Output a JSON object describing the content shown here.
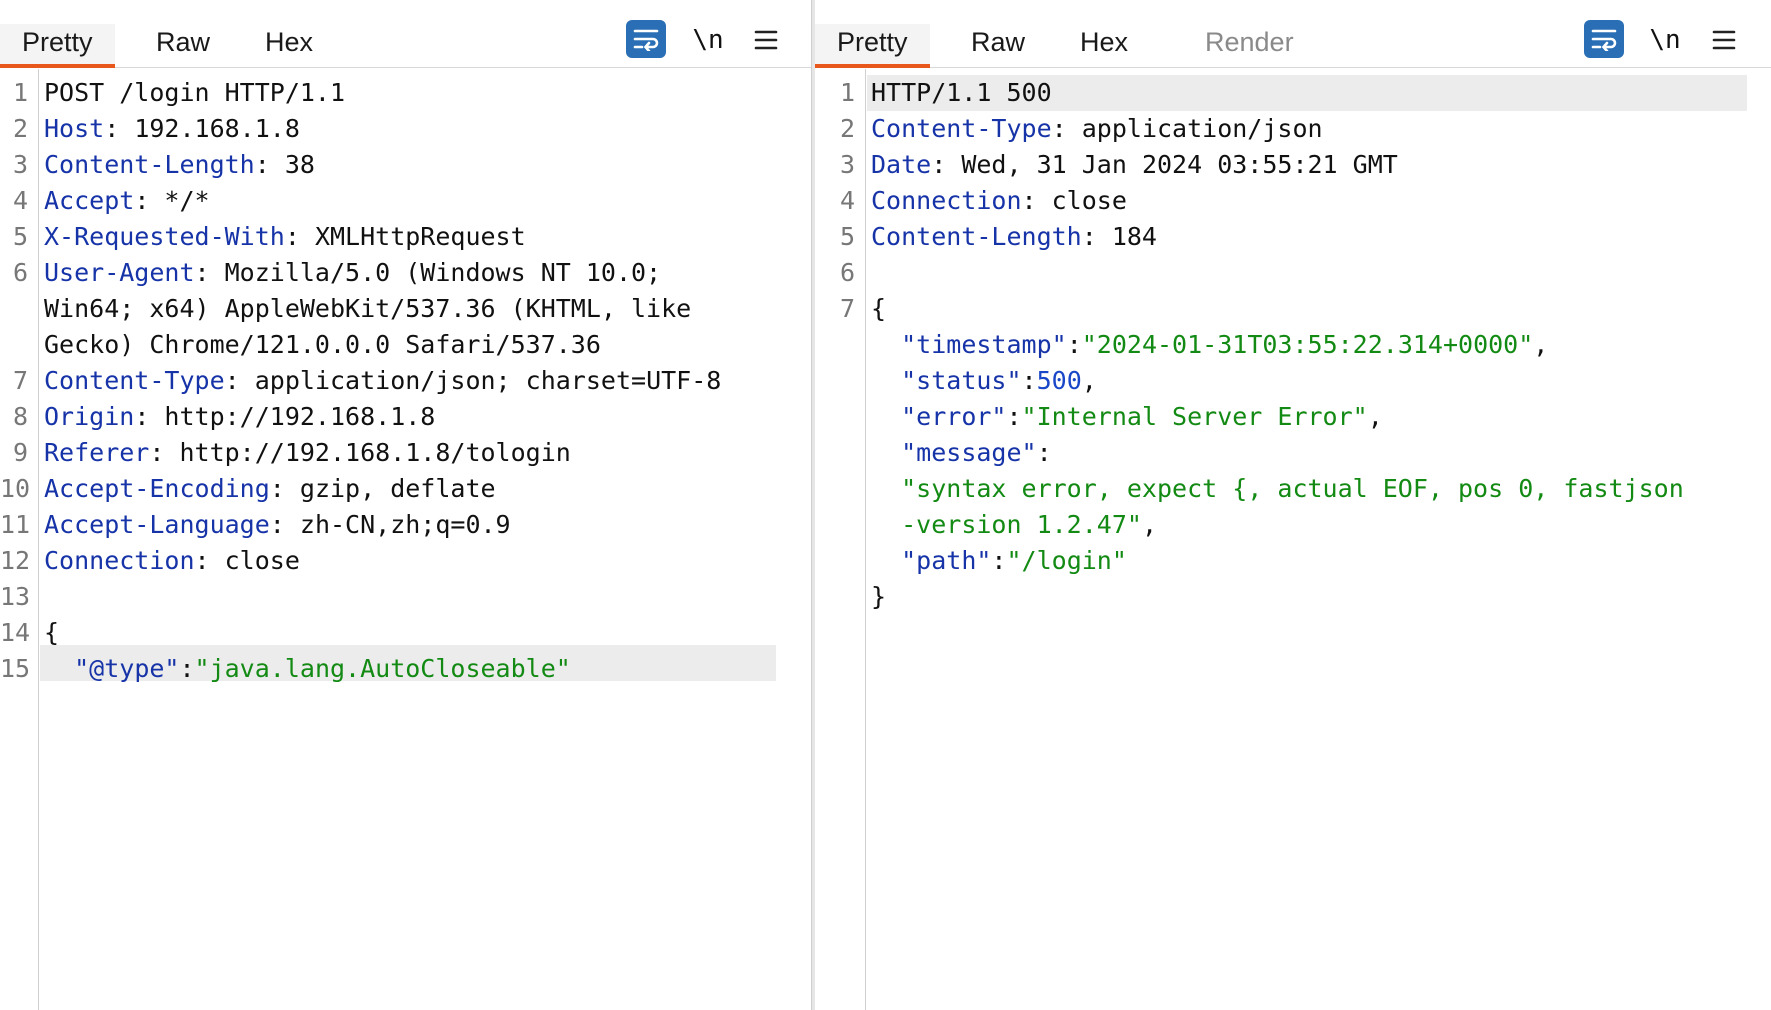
{
  "colors": {
    "accent": "#e8581c",
    "header_key": "#1633a8",
    "string": "#138a13",
    "number": "#1a47c8",
    "button": "#2a6fb5"
  },
  "request": {
    "tabs": [
      {
        "label": "Pretty",
        "active": true
      },
      {
        "label": "Raw",
        "active": false
      },
      {
        "label": "Hex",
        "active": false
      }
    ],
    "toolbar": {
      "wrap_icon": "wrap-lines-icon",
      "newline_label": "\\n",
      "menu_icon": "hamburger-menu-icon"
    },
    "line_numbers": [
      "1",
      "2",
      "3",
      "4",
      "5",
      "6",
      "",
      "",
      "7",
      "8",
      "9",
      "10",
      "11",
      "12",
      "13",
      "14",
      "15"
    ],
    "lines": [
      {
        "plain": "POST /login HTTP/1.1"
      },
      {
        "key": "Host",
        "sep": ": ",
        "val": "192.168.1.8"
      },
      {
        "key": "Content-Length",
        "sep": ": ",
        "val": "38"
      },
      {
        "key": "Accept",
        "sep": ": ",
        "val": "*/*"
      },
      {
        "key": "X-Requested-With",
        "sep": ": ",
        "val": "XMLHttpRequest"
      },
      {
        "key": "User-Agent",
        "sep": ": ",
        "val": "Mozilla/5.0 (Windows NT 10.0;"
      },
      {
        "plain": "Win64; x64) AppleWebKit/537.36 (KHTML, like"
      },
      {
        "plain": "Gecko) Chrome/121.0.0.0 Safari/537.36"
      },
      {
        "key": "Content-Type",
        "sep": ": ",
        "val": "application/json; charset=UTF-8"
      },
      {
        "key": "Origin",
        "sep": ": ",
        "val": "http://192.168.1.8"
      },
      {
        "key": "Referer",
        "sep": ": ",
        "val": "http://192.168.1.8/tologin"
      },
      {
        "key": "Accept-Encoding",
        "sep": ": ",
        "val": "gzip, deflate"
      },
      {
        "key": "Accept-Language",
        "sep": ": ",
        "val": "zh-CN,zh;q=0.9"
      },
      {
        "key": "Connection",
        "sep": ": ",
        "val": "close"
      },
      {
        "plain": ""
      },
      {
        "plain": "{"
      },
      {
        "indent": "  ",
        "jkey": "\"@type\"",
        "colon": ":",
        "str": "\"java.lang.AutoCloseable\""
      }
    ]
  },
  "response": {
    "tabs": [
      {
        "label": "Pretty",
        "active": true
      },
      {
        "label": "Raw",
        "active": false
      },
      {
        "label": "Hex",
        "active": false
      },
      {
        "label": "Render",
        "active": false
      }
    ],
    "toolbar": {
      "wrap_icon": "wrap-lines-icon",
      "newline_label": "\\n",
      "menu_icon": "hamburger-menu-icon"
    },
    "line_numbers": [
      "1",
      "2",
      "3",
      "4",
      "5",
      "6",
      "7"
    ],
    "lines": [
      {
        "plain": "HTTP/1.1 500"
      },
      {
        "key": "Content-Type",
        "sep": ": ",
        "val": "application/json"
      },
      {
        "key": "Date",
        "sep": ": ",
        "val": "Wed, 31 Jan 2024 03:55:21 GMT"
      },
      {
        "key": "Connection",
        "sep": ": ",
        "val": "close"
      },
      {
        "key": "Content-Length",
        "sep": ": ",
        "val": "184"
      },
      {
        "plain": ""
      },
      {
        "plain": "{"
      },
      {
        "indent": "  ",
        "jkey": "\"timestamp\"",
        "colon": ":",
        "str": "\"2024-01-31T03:55:22.314+0000\"",
        "tail": ","
      },
      {
        "indent": "  ",
        "jkey": "\"status\"",
        "colon": ":",
        "num": "500",
        "tail": ","
      },
      {
        "indent": "  ",
        "jkey": "\"error\"",
        "colon": ":",
        "str": "\"Internal Server Error\"",
        "tail": ","
      },
      {
        "indent": "  ",
        "jkey": "\"message\"",
        "colon": ":"
      },
      {
        "indent": "  ",
        "str": "\"syntax error, expect {, actual EOF, pos 0, fastjson"
      },
      {
        "indent": "  ",
        "str": "-version 1.2.47\"",
        "tail": ","
      },
      {
        "indent": "  ",
        "jkey": "\"path\"",
        "colon": ":",
        "str": "\"/login\""
      },
      {
        "plain": "}"
      }
    ]
  }
}
